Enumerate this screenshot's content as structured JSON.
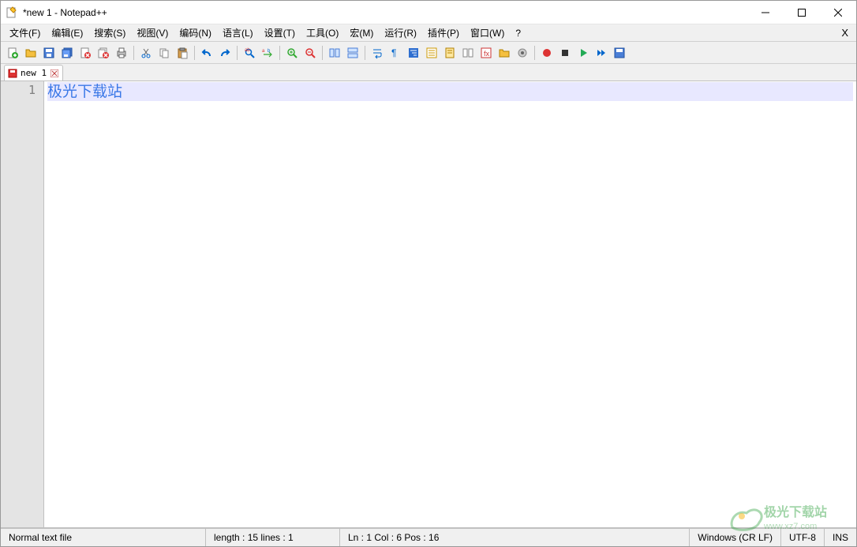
{
  "window": {
    "title": "*new 1 - Notepad++"
  },
  "menubar": {
    "items": [
      "文件(F)",
      "编辑(E)",
      "搜索(S)",
      "视图(V)",
      "编码(N)",
      "语言(L)",
      "设置(T)",
      "工具(O)",
      "宏(M)",
      "运行(R)",
      "插件(P)",
      "窗口(W)",
      "?"
    ],
    "right_x": "X"
  },
  "tabs": [
    {
      "label": "new 1"
    }
  ],
  "editor": {
    "line_numbers": [
      "1"
    ],
    "lines": [
      {
        "text": "极光下载站",
        "active": true
      }
    ]
  },
  "statusbar": {
    "filetype": "Normal text file",
    "length_lines": "length : 15    lines : 1",
    "cursor": "Ln : 1    Col : 6    Pos : 16",
    "eol": "Windows (CR LF)",
    "encoding": "UTF-8",
    "insert_mode": "INS"
  },
  "watermark": {
    "brand": "极光下载站",
    "url": "www.xz7.com"
  }
}
